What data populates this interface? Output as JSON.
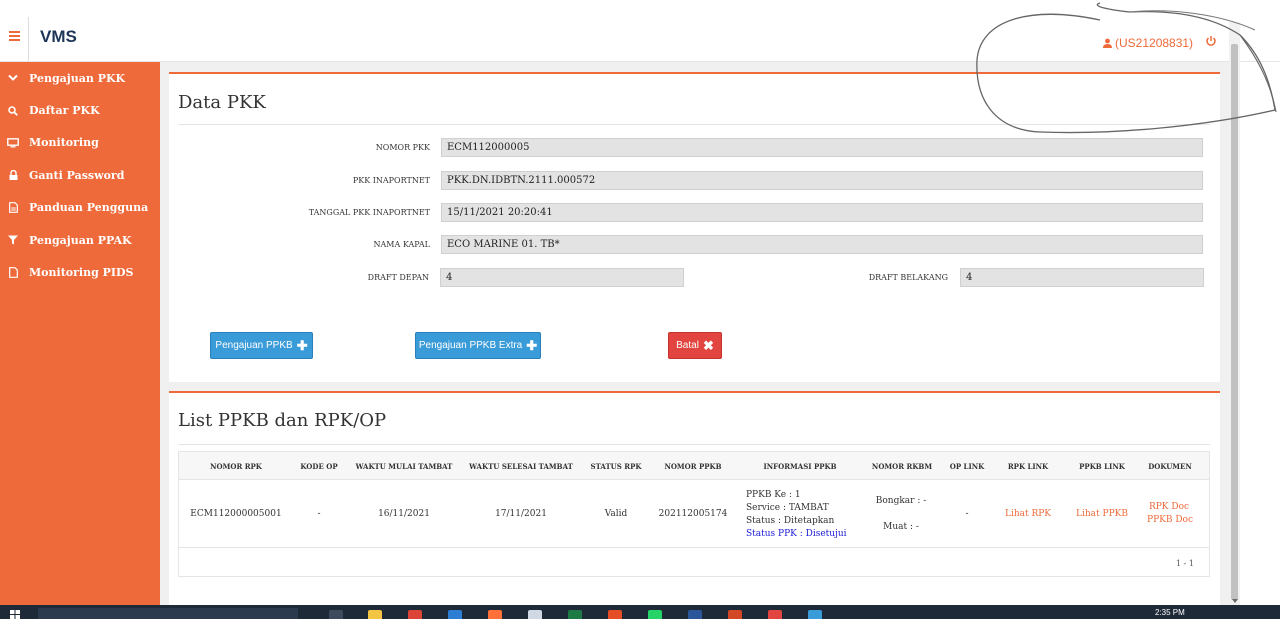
{
  "app": {
    "title": "VMS",
    "user": "(US21208831)"
  },
  "sidebar": {
    "items": [
      {
        "label": "Pengajuan PKK",
        "icon": "chevron-down-icon"
      },
      {
        "label": "Daftar PKK",
        "icon": "search-icon"
      },
      {
        "label": "Monitoring",
        "icon": "monitor-icon"
      },
      {
        "label": "Ganti Password",
        "icon": "lock-icon"
      },
      {
        "label": "Panduan Pengguna",
        "icon": "document-icon"
      },
      {
        "label": "Pengajuan PPAK",
        "icon": "filter-icon"
      },
      {
        "label": "Monitoring PIDS",
        "icon": "file-icon"
      }
    ]
  },
  "data_pkk": {
    "title": "Data PKK",
    "fields": {
      "nomor_pkk": {
        "label": "NOMOR PKK",
        "value": "ECM112000005"
      },
      "pkk_inaportnet": {
        "label": "PKK INAPORTNET",
        "value": "PKK.DN.IDBTN.2111.000572"
      },
      "tanggal_pkk_inaportnet": {
        "label": "TANGGAL PKK INAPORTNET",
        "value": "15/11/2021 20:20:41"
      },
      "nama_kapal": {
        "label": "NAMA KAPAL",
        "value": "ECO MARINE 01. TB*"
      },
      "draft_depan": {
        "label": "DRAFT DEPAN",
        "value": "4"
      },
      "draft_belakang": {
        "label": "DRAFT BELAKANG",
        "value": "4"
      }
    },
    "buttons": {
      "pengajuan_ppkb": "Pengajuan PPKB",
      "pengajuan_ppkb_extra": "Pengajuan PPKB Extra",
      "batal": "Batal"
    }
  },
  "list": {
    "title": "List PPKB dan RPK/OP",
    "columns": [
      "NOMOR RPK",
      "KODE OP",
      "WAKTU MULAI TAMBAT",
      "WAKTU SELESAI TAMBAT",
      "STATUS RPK",
      "NOMOR PPKB",
      "INFORMASI PPKB",
      "NOMOR RKBM",
      "OP LINK",
      "RPK LINK",
      "PPKB LINK",
      "DOKUMEN"
    ],
    "row": {
      "nomor_rpk": "ECM112000005001",
      "kode_op": "-",
      "waktu_mulai": "16/11/2021",
      "waktu_selesai": "17/11/2021",
      "status_rpk": "Valid",
      "nomor_ppkb": "202112005174",
      "info_ppkb_ke": "PPKB Ke : 1",
      "info_service": "Service : TAMBAT",
      "info_status": "Status : Ditetapkan",
      "info_status_ppk": "Status PPK : Disetujui",
      "rkbm_bongkar": "Bongkar : -",
      "rkbm_muat": "Muat : -",
      "op_link": "-",
      "rpk_link": "Lihat RPK",
      "ppkb_link": "Lihat PPKB",
      "rpk_doc": "RPK Doc",
      "ppkb_doc": "PPKB Doc"
    },
    "pager": "1 - 1"
  },
  "taskbar": {
    "time": "2:35 PM"
  },
  "colors": {
    "accent": "#ee6a3b",
    "button_blue": "#3a9bd9",
    "button_red": "#e2453f",
    "link_blue": "#1a1ad8"
  }
}
